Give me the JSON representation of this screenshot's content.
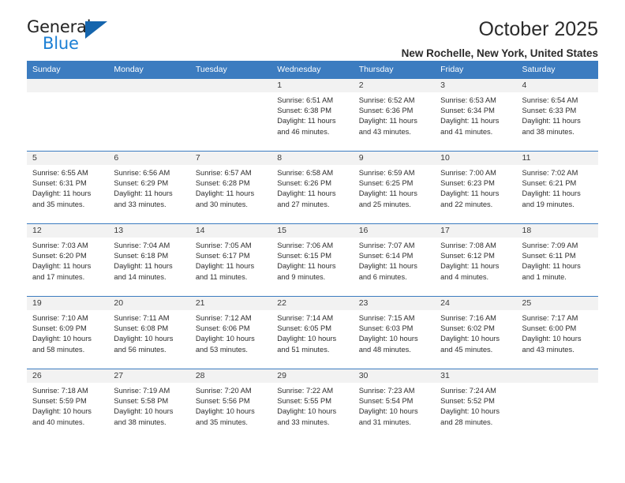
{
  "brand": {
    "name_top": "General",
    "name_bottom": "Blue",
    "accent_color": "#1b7fd4",
    "triangle_color": "#1565ad"
  },
  "header": {
    "title": "October 2025",
    "subtitle": "New Rochelle, New York, United States"
  },
  "calendar": {
    "header_background": "#3c7cc0",
    "header_text_color": "#ffffff",
    "weekdays": [
      "Sunday",
      "Monday",
      "Tuesday",
      "Wednesday",
      "Thursday",
      "Friday",
      "Saturday"
    ],
    "weeks": [
      [
        {
          "day": "",
          "empty": true,
          "sunrise": "",
          "sunset": "",
          "daylight_line1": "",
          "daylight_line2": ""
        },
        {
          "day": "",
          "empty": true,
          "sunrise": "",
          "sunset": "",
          "daylight_line1": "",
          "daylight_line2": ""
        },
        {
          "day": "",
          "empty": true,
          "sunrise": "",
          "sunset": "",
          "daylight_line1": "",
          "daylight_line2": ""
        },
        {
          "day": "1",
          "empty": false,
          "sunrise": "Sunrise: 6:51 AM",
          "sunset": "Sunset: 6:38 PM",
          "daylight_line1": "Daylight: 11 hours",
          "daylight_line2": "and 46 minutes."
        },
        {
          "day": "2",
          "empty": false,
          "sunrise": "Sunrise: 6:52 AM",
          "sunset": "Sunset: 6:36 PM",
          "daylight_line1": "Daylight: 11 hours",
          "daylight_line2": "and 43 minutes."
        },
        {
          "day": "3",
          "empty": false,
          "sunrise": "Sunrise: 6:53 AM",
          "sunset": "Sunset: 6:34 PM",
          "daylight_line1": "Daylight: 11 hours",
          "daylight_line2": "and 41 minutes."
        },
        {
          "day": "4",
          "empty": false,
          "sunrise": "Sunrise: 6:54 AM",
          "sunset": "Sunset: 6:33 PM",
          "daylight_line1": "Daylight: 11 hours",
          "daylight_line2": "and 38 minutes."
        }
      ],
      [
        {
          "day": "5",
          "empty": false,
          "sunrise": "Sunrise: 6:55 AM",
          "sunset": "Sunset: 6:31 PM",
          "daylight_line1": "Daylight: 11 hours",
          "daylight_line2": "and 35 minutes."
        },
        {
          "day": "6",
          "empty": false,
          "sunrise": "Sunrise: 6:56 AM",
          "sunset": "Sunset: 6:29 PM",
          "daylight_line1": "Daylight: 11 hours",
          "daylight_line2": "and 33 minutes."
        },
        {
          "day": "7",
          "empty": false,
          "sunrise": "Sunrise: 6:57 AM",
          "sunset": "Sunset: 6:28 PM",
          "daylight_line1": "Daylight: 11 hours",
          "daylight_line2": "and 30 minutes."
        },
        {
          "day": "8",
          "empty": false,
          "sunrise": "Sunrise: 6:58 AM",
          "sunset": "Sunset: 6:26 PM",
          "daylight_line1": "Daylight: 11 hours",
          "daylight_line2": "and 27 minutes."
        },
        {
          "day": "9",
          "empty": false,
          "sunrise": "Sunrise: 6:59 AM",
          "sunset": "Sunset: 6:25 PM",
          "daylight_line1": "Daylight: 11 hours",
          "daylight_line2": "and 25 minutes."
        },
        {
          "day": "10",
          "empty": false,
          "sunrise": "Sunrise: 7:00 AM",
          "sunset": "Sunset: 6:23 PM",
          "daylight_line1": "Daylight: 11 hours",
          "daylight_line2": "and 22 minutes."
        },
        {
          "day": "11",
          "empty": false,
          "sunrise": "Sunrise: 7:02 AM",
          "sunset": "Sunset: 6:21 PM",
          "daylight_line1": "Daylight: 11 hours",
          "daylight_line2": "and 19 minutes."
        }
      ],
      [
        {
          "day": "12",
          "empty": false,
          "sunrise": "Sunrise: 7:03 AM",
          "sunset": "Sunset: 6:20 PM",
          "daylight_line1": "Daylight: 11 hours",
          "daylight_line2": "and 17 minutes."
        },
        {
          "day": "13",
          "empty": false,
          "sunrise": "Sunrise: 7:04 AM",
          "sunset": "Sunset: 6:18 PM",
          "daylight_line1": "Daylight: 11 hours",
          "daylight_line2": "and 14 minutes."
        },
        {
          "day": "14",
          "empty": false,
          "sunrise": "Sunrise: 7:05 AM",
          "sunset": "Sunset: 6:17 PM",
          "daylight_line1": "Daylight: 11 hours",
          "daylight_line2": "and 11 minutes."
        },
        {
          "day": "15",
          "empty": false,
          "sunrise": "Sunrise: 7:06 AM",
          "sunset": "Sunset: 6:15 PM",
          "daylight_line1": "Daylight: 11 hours",
          "daylight_line2": "and 9 minutes."
        },
        {
          "day": "16",
          "empty": false,
          "sunrise": "Sunrise: 7:07 AM",
          "sunset": "Sunset: 6:14 PM",
          "daylight_line1": "Daylight: 11 hours",
          "daylight_line2": "and 6 minutes."
        },
        {
          "day": "17",
          "empty": false,
          "sunrise": "Sunrise: 7:08 AM",
          "sunset": "Sunset: 6:12 PM",
          "daylight_line1": "Daylight: 11 hours",
          "daylight_line2": "and 4 minutes."
        },
        {
          "day": "18",
          "empty": false,
          "sunrise": "Sunrise: 7:09 AM",
          "sunset": "Sunset: 6:11 PM",
          "daylight_line1": "Daylight: 11 hours",
          "daylight_line2": "and 1 minute."
        }
      ],
      [
        {
          "day": "19",
          "empty": false,
          "sunrise": "Sunrise: 7:10 AM",
          "sunset": "Sunset: 6:09 PM",
          "daylight_line1": "Daylight: 10 hours",
          "daylight_line2": "and 58 minutes."
        },
        {
          "day": "20",
          "empty": false,
          "sunrise": "Sunrise: 7:11 AM",
          "sunset": "Sunset: 6:08 PM",
          "daylight_line1": "Daylight: 10 hours",
          "daylight_line2": "and 56 minutes."
        },
        {
          "day": "21",
          "empty": false,
          "sunrise": "Sunrise: 7:12 AM",
          "sunset": "Sunset: 6:06 PM",
          "daylight_line1": "Daylight: 10 hours",
          "daylight_line2": "and 53 minutes."
        },
        {
          "day": "22",
          "empty": false,
          "sunrise": "Sunrise: 7:14 AM",
          "sunset": "Sunset: 6:05 PM",
          "daylight_line1": "Daylight: 10 hours",
          "daylight_line2": "and 51 minutes."
        },
        {
          "day": "23",
          "empty": false,
          "sunrise": "Sunrise: 7:15 AM",
          "sunset": "Sunset: 6:03 PM",
          "daylight_line1": "Daylight: 10 hours",
          "daylight_line2": "and 48 minutes."
        },
        {
          "day": "24",
          "empty": false,
          "sunrise": "Sunrise: 7:16 AM",
          "sunset": "Sunset: 6:02 PM",
          "daylight_line1": "Daylight: 10 hours",
          "daylight_line2": "and 45 minutes."
        },
        {
          "day": "25",
          "empty": false,
          "sunrise": "Sunrise: 7:17 AM",
          "sunset": "Sunset: 6:00 PM",
          "daylight_line1": "Daylight: 10 hours",
          "daylight_line2": "and 43 minutes."
        }
      ],
      [
        {
          "day": "26",
          "empty": false,
          "sunrise": "Sunrise: 7:18 AM",
          "sunset": "Sunset: 5:59 PM",
          "daylight_line1": "Daylight: 10 hours",
          "daylight_line2": "and 40 minutes."
        },
        {
          "day": "27",
          "empty": false,
          "sunrise": "Sunrise: 7:19 AM",
          "sunset": "Sunset: 5:58 PM",
          "daylight_line1": "Daylight: 10 hours",
          "daylight_line2": "and 38 minutes."
        },
        {
          "day": "28",
          "empty": false,
          "sunrise": "Sunrise: 7:20 AM",
          "sunset": "Sunset: 5:56 PM",
          "daylight_line1": "Daylight: 10 hours",
          "daylight_line2": "and 35 minutes."
        },
        {
          "day": "29",
          "empty": false,
          "sunrise": "Sunrise: 7:22 AM",
          "sunset": "Sunset: 5:55 PM",
          "daylight_line1": "Daylight: 10 hours",
          "daylight_line2": "and 33 minutes."
        },
        {
          "day": "30",
          "empty": false,
          "sunrise": "Sunrise: 7:23 AM",
          "sunset": "Sunset: 5:54 PM",
          "daylight_line1": "Daylight: 10 hours",
          "daylight_line2": "and 31 minutes."
        },
        {
          "day": "31",
          "empty": false,
          "sunrise": "Sunrise: 7:24 AM",
          "sunset": "Sunset: 5:52 PM",
          "daylight_line1": "Daylight: 10 hours",
          "daylight_line2": "and 28 minutes."
        },
        {
          "day": "",
          "empty": true,
          "sunrise": "",
          "sunset": "",
          "daylight_line1": "",
          "daylight_line2": ""
        }
      ]
    ]
  }
}
